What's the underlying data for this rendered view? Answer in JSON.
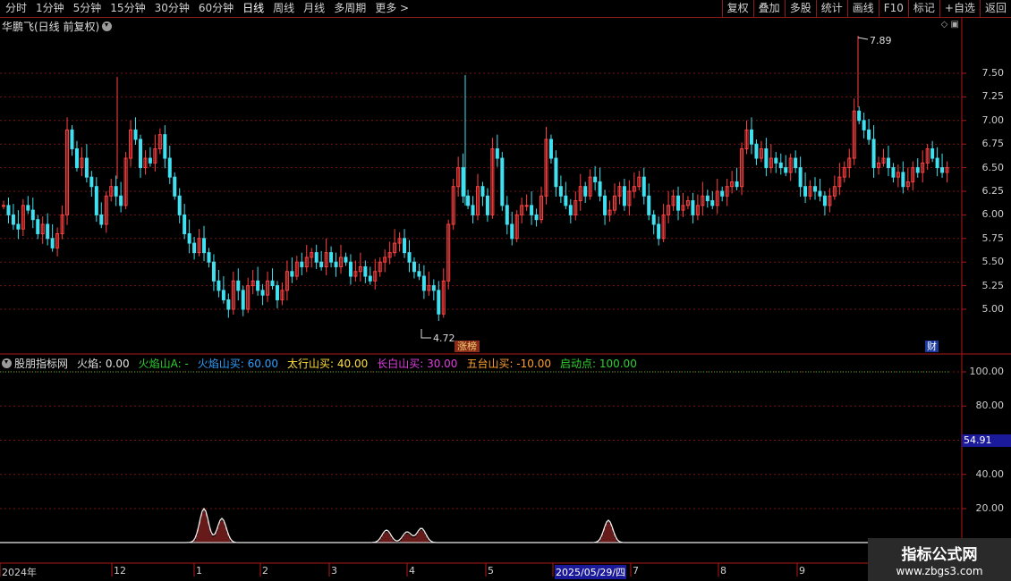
{
  "toolbar": {
    "periods": [
      "分时",
      "1分钟",
      "5分钟",
      "15分钟",
      "30分钟",
      "60分钟",
      "日线",
      "周线",
      "月线",
      "多周期",
      "更多 >"
    ],
    "active_period": "日线",
    "buttons": [
      "复权",
      "叠加",
      "多股",
      "统计",
      "画线",
      "F10",
      "标记",
      "+自选",
      "返回"
    ]
  },
  "main_chart": {
    "title": "华鹏飞(日线 前复权)",
    "high_label": "7.89",
    "low_label": "4.72",
    "badge_limit": "涨榜",
    "badge_finance": "财",
    "y_ticks": [
      "7.50",
      "7.25",
      "7.00",
      "6.75",
      "6.50",
      "6.25",
      "6.00",
      "5.75",
      "5.50",
      "5.25",
      "5.00"
    ]
  },
  "indicator": {
    "name": "股朋指标网",
    "items": [
      {
        "label": "火焰: 0.00",
        "color": "#e0e0e0"
      },
      {
        "label": "火焰山A: -",
        "color": "#30d030"
      },
      {
        "label": "火焰山买: 60.00",
        "color": "#30a0ff"
      },
      {
        "label": "太行山买: 40.00",
        "color": "#ffe040"
      },
      {
        "label": "长白山买: 30.00",
        "color": "#e040e0"
      },
      {
        "label": "五台山买: -10.00",
        "color": "#ffa030"
      },
      {
        "label": "启动点: 100.00",
        "color": "#30d030"
      }
    ],
    "y_ticks": [
      "100.00",
      "80.00",
      "40.00",
      "20.00"
    ],
    "current_value": "54.91"
  },
  "x_axis": {
    "labels": [
      "2024年",
      "12",
      "1",
      "2",
      "3",
      "4",
      "5",
      "2025/05/29/四",
      "7",
      "8",
      "9"
    ]
  },
  "watermark": {
    "line1": "指标公式网",
    "line2": "www.zbgs3.com"
  },
  "colors": {
    "up": "#ff4040",
    "down": "#40e0f0",
    "grid": "#8b1a1a",
    "axis": "#c02020"
  },
  "chart_data": {
    "type": "candlestick",
    "title": "华鹏飞(日线 前复权)",
    "ylim": [
      4.75,
      7.75
    ],
    "marked_high": 7.89,
    "marked_low": 4.72,
    "closes": [
      6.1,
      6.0,
      5.9,
      5.85,
      6.1,
      6.05,
      5.95,
      5.8,
      5.9,
      5.75,
      5.65,
      5.8,
      6.0,
      6.9,
      6.7,
      6.5,
      6.6,
      6.4,
      6.3,
      6.0,
      5.9,
      6.2,
      6.3,
      6.2,
      6.1,
      6.6,
      6.9,
      6.8,
      6.5,
      6.6,
      6.55,
      6.7,
      6.85,
      6.6,
      6.4,
      6.2,
      6.0,
      5.8,
      5.7,
      5.6,
      5.75,
      5.6,
      5.5,
      5.3,
      5.2,
      5.1,
      5.0,
      5.3,
      5.2,
      5.0,
      5.25,
      5.3,
      5.2,
      5.15,
      5.3,
      5.25,
      5.1,
      5.2,
      5.4,
      5.35,
      5.5,
      5.45,
      5.55,
      5.6,
      5.5,
      5.45,
      5.6,
      5.5,
      5.45,
      5.55,
      5.5,
      5.35,
      5.4,
      5.45,
      5.35,
      5.3,
      5.4,
      5.5,
      5.55,
      5.6,
      5.7,
      5.75,
      5.6,
      5.5,
      5.4,
      5.35,
      5.2,
      5.25,
      5.2,
      4.95,
      5.3,
      5.9,
      6.3,
      6.5,
      6.2,
      6.1,
      6.0,
      6.3,
      6.2,
      6.0,
      6.7,
      6.6,
      6.1,
      5.9,
      5.75,
      6.0,
      6.1,
      6.1,
      6.0,
      5.95,
      6.2,
      6.8,
      6.6,
      6.3,
      6.2,
      6.1,
      6.0,
      6.15,
      6.3,
      6.2,
      6.4,
      6.35,
      6.2,
      6.0,
      6.05,
      6.2,
      6.3,
      6.1,
      6.25,
      6.3,
      6.4,
      6.2,
      6.0,
      5.9,
      5.75,
      6.0,
      6.1,
      6.2,
      6.05,
      6.1,
      6.15,
      6.0,
      6.1,
      6.2,
      6.15,
      6.1,
      6.25,
      6.2,
      6.3,
      6.35,
      6.3,
      6.7,
      6.9,
      6.75,
      6.6,
      6.7,
      6.5,
      6.6,
      6.55,
      6.5,
      6.45,
      6.6,
      6.5,
      6.3,
      6.2,
      6.3,
      6.25,
      6.2,
      6.1,
      6.2,
      6.3,
      6.4,
      6.5,
      6.6,
      7.1,
      7.0,
      6.9,
      6.8,
      6.5,
      6.55,
      6.6,
      6.5,
      6.4,
      6.45,
      6.3,
      6.35,
      6.5,
      6.45,
      6.55,
      6.7,
      6.6,
      6.5,
      6.45,
      6.5
    ]
  }
}
